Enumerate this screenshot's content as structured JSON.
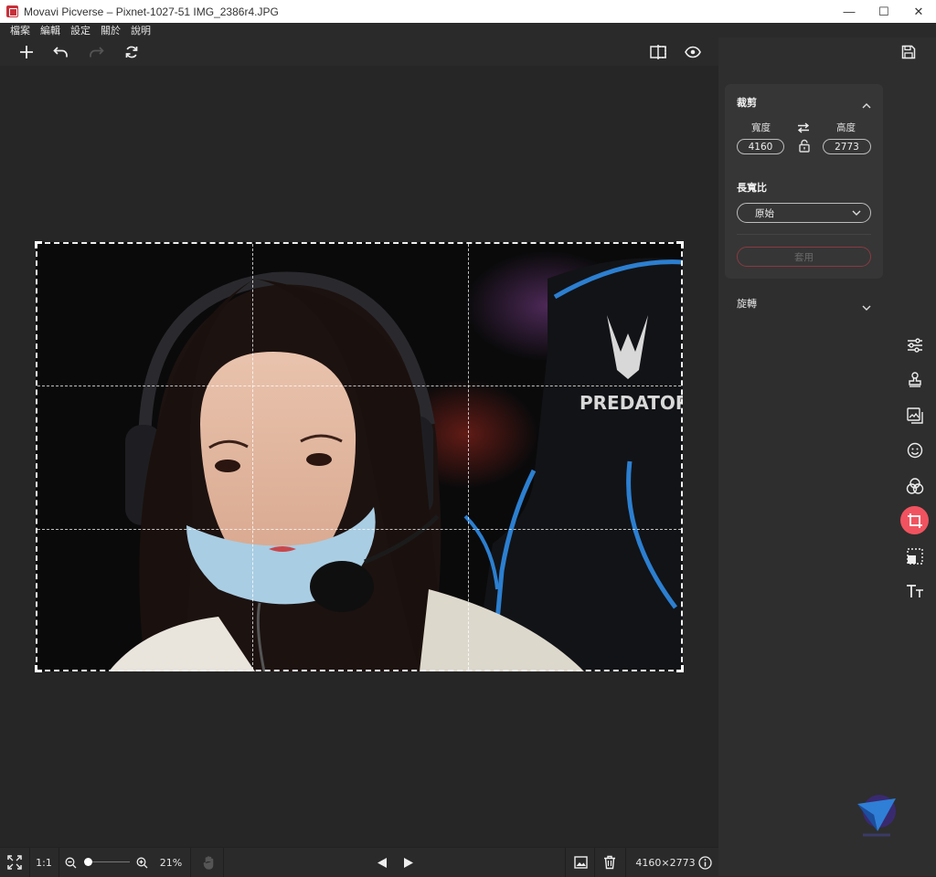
{
  "window": {
    "title": "Movavi Picverse – Pixnet-1027-51 IMG_2386r4.JPG",
    "minimize_glyph": "—",
    "maximize_glyph": "☐",
    "close_glyph": "✕"
  },
  "menu": {
    "items": [
      "檔案",
      "編輯",
      "設定",
      "關於",
      "說明"
    ]
  },
  "toolbar": {
    "add_icon": "plus-icon",
    "undo_icon": "undo-icon",
    "redo_icon": "redo-icon",
    "reset_icon": "reset-icon",
    "compare_icon": "compare-icon",
    "preview_icon": "eye-icon",
    "save_icon": "save-icon"
  },
  "crop_panel": {
    "title": "裁剪",
    "width_label": "寬度",
    "height_label": "高度",
    "width_value": "4160",
    "height_value": "2773",
    "aspect_label": "長寬比",
    "aspect_value": "原始",
    "apply_label": "套用"
  },
  "rotate_panel": {
    "title": "旋轉"
  },
  "side_tools": [
    {
      "name": "adjust-icon"
    },
    {
      "name": "stamp-icon"
    },
    {
      "name": "background-icon"
    },
    {
      "name": "face-icon"
    },
    {
      "name": "filters-icon"
    },
    {
      "name": "crop-icon",
      "active": true
    },
    {
      "name": "resize-icon"
    },
    {
      "name": "text-icon"
    }
  ],
  "photo": {
    "text_on_chair": "PREDATOR"
  },
  "status": {
    "ratio_label": "1:1",
    "zoom_percent": "21%",
    "image_size": "4160×2773",
    "zoom_slider_value": 0.0
  },
  "colors": {
    "accent": "#f0535f",
    "background": "#2a2a2a",
    "panel": "#363636"
  }
}
